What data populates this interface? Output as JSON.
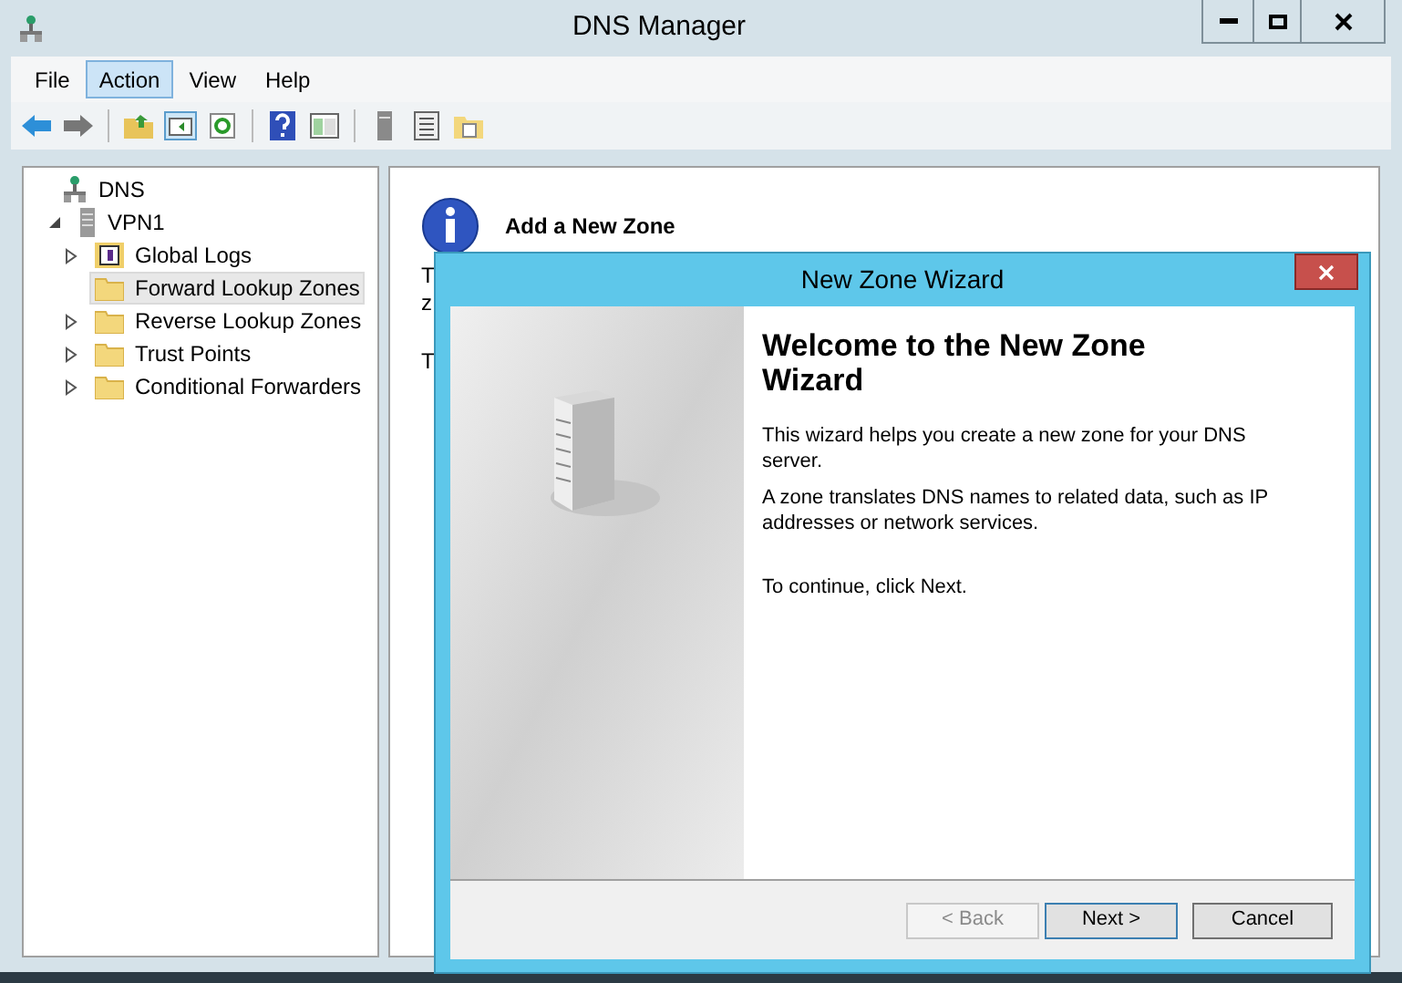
{
  "window": {
    "title": "DNS Manager"
  },
  "menu": [
    {
      "label": "File",
      "selected": false
    },
    {
      "label": "Action",
      "selected": true
    },
    {
      "label": "View",
      "selected": false
    },
    {
      "label": "Help",
      "selected": false
    }
  ],
  "tree": [
    {
      "label": "DNS",
      "kind": "dns",
      "selected": false,
      "children": [
        {
          "label": "VPN1",
          "kind": "server",
          "expanded": true,
          "selected": false,
          "children": [
            {
              "label": "Global Logs",
              "kind": "log",
              "expanded": false,
              "selected": false
            },
            {
              "label": "Forward Lookup Zones",
              "kind": "folder",
              "selected": true
            },
            {
              "label": "Reverse Lookup Zones",
              "kind": "folder",
              "expanded": false,
              "selected": false
            },
            {
              "label": "Trust Points",
              "kind": "folder",
              "expanded": false,
              "selected": false
            },
            {
              "label": "Conditional Forwarders",
              "kind": "folder",
              "expanded": false,
              "selected": false
            }
          ]
        }
      ]
    }
  ],
  "details": {
    "heading": "Add a New Zone",
    "fragments": [
      "T",
      "z",
      "T"
    ]
  },
  "wizard": {
    "title": "New Zone Wizard",
    "heading": "Welcome to the New Zone Wizard",
    "paragraphs": [
      "This wizard helps you create a new zone for your DNS server.",
      "A zone translates DNS names to related data, such as IP addresses or network services.",
      "To continue, click Next."
    ],
    "buttons": [
      {
        "label": "< Back",
        "disabled": true,
        "default": false
      },
      {
        "label": "Next >",
        "disabled": false,
        "default": true
      },
      {
        "label": "Cancel",
        "disabled": false,
        "default": false
      }
    ]
  }
}
